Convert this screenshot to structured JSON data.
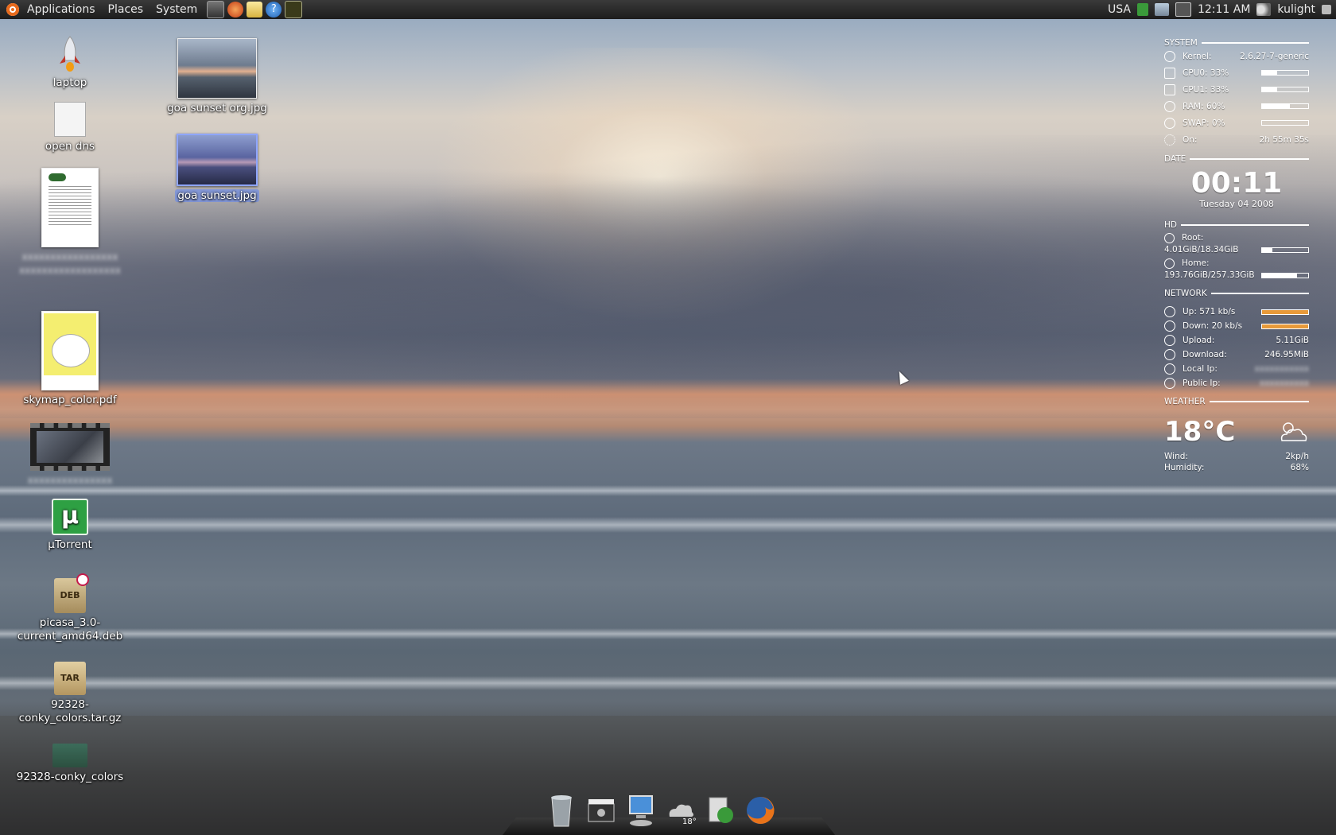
{
  "panel": {
    "menus": [
      "Applications",
      "Places",
      "System"
    ],
    "keyboard_layout": "USA",
    "clock": "12:11 AM",
    "user": "kulight"
  },
  "desktop": {
    "icons": [
      {
        "label": "laptop"
      },
      {
        "label": "open dns"
      },
      {
        "label": "skymap_color.pdf"
      },
      {
        "label": "µTorrent"
      },
      {
        "label": "picasa_3.0-current_amd64.deb"
      },
      {
        "label": "92328-conky_colors.tar.gz"
      },
      {
        "label": "92328-conky_colors"
      },
      {
        "label": "goa sunset org.jpg"
      },
      {
        "label": "goa sunset.jpg"
      }
    ],
    "type_badges": {
      "deb": "DEB",
      "tar": "TAR",
      "torrent": "µ"
    }
  },
  "conky": {
    "system": {
      "title": "SYSTEM",
      "kernel_label": "Kernel:",
      "kernel_value": "2.6.27-7-generic",
      "cpu0": "CPU0: 33%",
      "cpu0_pct": 33,
      "cpu1": "CPU1: 33%",
      "cpu1_pct": 33,
      "ram": "RAM: 60%",
      "ram_pct": 60,
      "swap": "SWAP: 0%",
      "swap_pct": 0,
      "on_label": "On:",
      "on_value": "2h 55m 35s"
    },
    "date": {
      "title": "DATE",
      "time": "00:11",
      "day": "Tuesday 04 2008"
    },
    "hd": {
      "title": "HD",
      "root_label": "Root:",
      "root_value": "4.01GiB/18.34GiB",
      "root_pct": 22,
      "home_label": "Home:",
      "home_value": "193.76GiB/257.33GiB",
      "home_pct": 75
    },
    "network": {
      "title": "NETWORK",
      "up": "Up: 571 kb/s",
      "down": "Down: 20 kb/s",
      "upload_label": "Upload:",
      "upload_value": "5.11GiB",
      "download_label": "Download:",
      "download_value": "246.95MiB",
      "local_ip_label": "Local Ip:",
      "public_ip_label": "Public Ip:"
    },
    "weather": {
      "title": "WEATHER",
      "temp": "18°C",
      "wind_label": "Wind:",
      "wind_value": "2kp/h",
      "humidity_label": "Humidity:",
      "humidity_value": "68%"
    }
  },
  "dock": {
    "weather_temp": "18°"
  },
  "colors": {
    "panel_bg": "#1c1c1c",
    "ubuntu_orange": "#e86a1c",
    "net_bar": "#e89a3a",
    "selection": "#6e8ce6"
  }
}
